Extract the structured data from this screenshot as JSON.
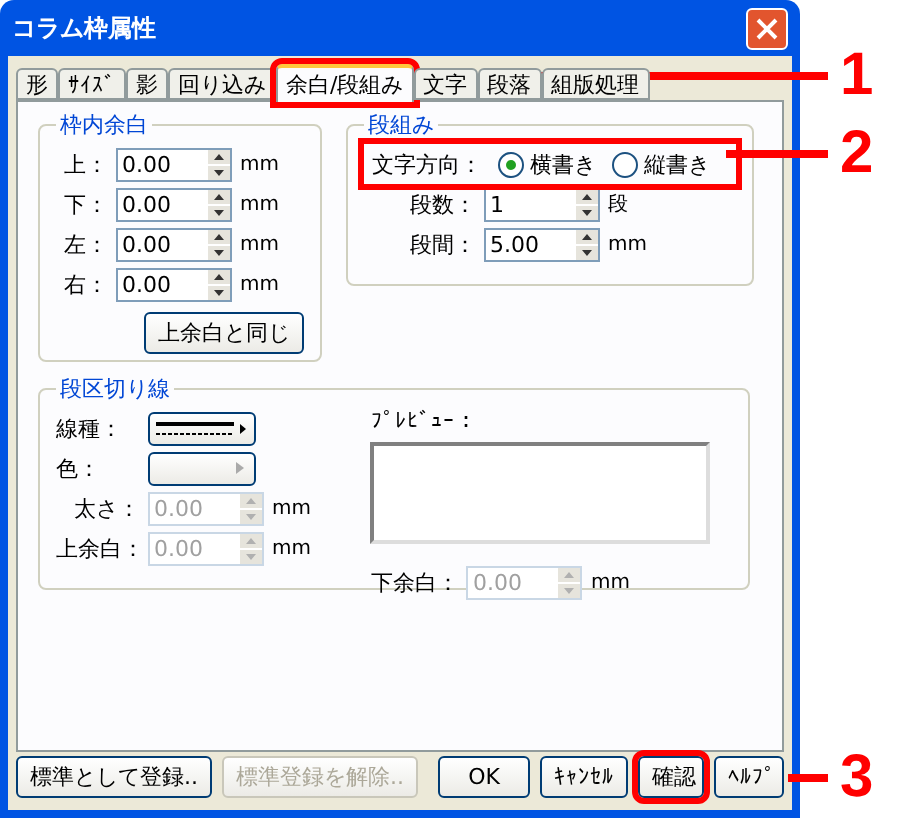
{
  "window": {
    "title": "コラム枠属性"
  },
  "tabs": [
    {
      "label": "形",
      "selected": false,
      "highlighted": false
    },
    {
      "label": "ｻｲｽﾞ",
      "selected": false,
      "highlighted": false
    },
    {
      "label": "影",
      "selected": false,
      "highlighted": false
    },
    {
      "label": "回り込み",
      "selected": false,
      "highlighted": false
    },
    {
      "label": "余白/段組み",
      "selected": true,
      "highlighted": true
    },
    {
      "label": "文字",
      "selected": false,
      "highlighted": false
    },
    {
      "label": "段落",
      "selected": false,
      "highlighted": false
    },
    {
      "label": "組版処理",
      "selected": false,
      "highlighted": false
    }
  ],
  "margins": {
    "title": "枠内余白",
    "fields": [
      {
        "label": "上：",
        "value": "0.00",
        "unit": "mm"
      },
      {
        "label": "下：",
        "value": "0.00",
        "unit": "mm"
      },
      {
        "label": "左：",
        "value": "0.00",
        "unit": "mm"
      },
      {
        "label": "右：",
        "value": "0.00",
        "unit": "mm"
      }
    ],
    "button": "上余白と同じ"
  },
  "columns": {
    "title": "段組み",
    "direction": {
      "label": "文字方向：",
      "highlighted": true,
      "options": [
        {
          "label": "横書き",
          "selected": true
        },
        {
          "label": "縦書き",
          "selected": false
        }
      ]
    },
    "fields": [
      {
        "label": "段数：",
        "value": "1",
        "unit": "段"
      },
      {
        "label": "段間：",
        "value": "5.00",
        "unit": "mm"
      }
    ]
  },
  "separator": {
    "title": "段区切り線",
    "line_type_label": "線種：",
    "color_label": "色：",
    "preview_label": "ﾌﾟﾚﾋﾞｭｰ：",
    "thickness": {
      "label": "太さ：",
      "value": "0.00",
      "unit": "mm",
      "disabled": true
    },
    "top": {
      "label": "上余白：",
      "value": "0.00",
      "unit": "mm",
      "disabled": true
    },
    "bottom": {
      "label": "下余白：",
      "value": "0.00",
      "unit": "mm",
      "disabled": true
    }
  },
  "buttons": [
    {
      "label": "標準として登録..",
      "disabled": false,
      "highlighted": false
    },
    {
      "label": "標準登録を解除..",
      "disabled": true,
      "highlighted": false
    },
    {
      "label": "OK",
      "disabled": false,
      "highlighted": false
    },
    {
      "label": "ｷｬﾝｾﾙ",
      "disabled": false,
      "highlighted": false
    },
    {
      "label": "確認",
      "disabled": false,
      "highlighted": true
    },
    {
      "label": "ﾍﾙﾌﾟ",
      "disabled": false,
      "highlighted": false
    }
  ],
  "callouts": [
    {
      "number": "1"
    },
    {
      "number": "2"
    },
    {
      "number": "3"
    }
  ]
}
